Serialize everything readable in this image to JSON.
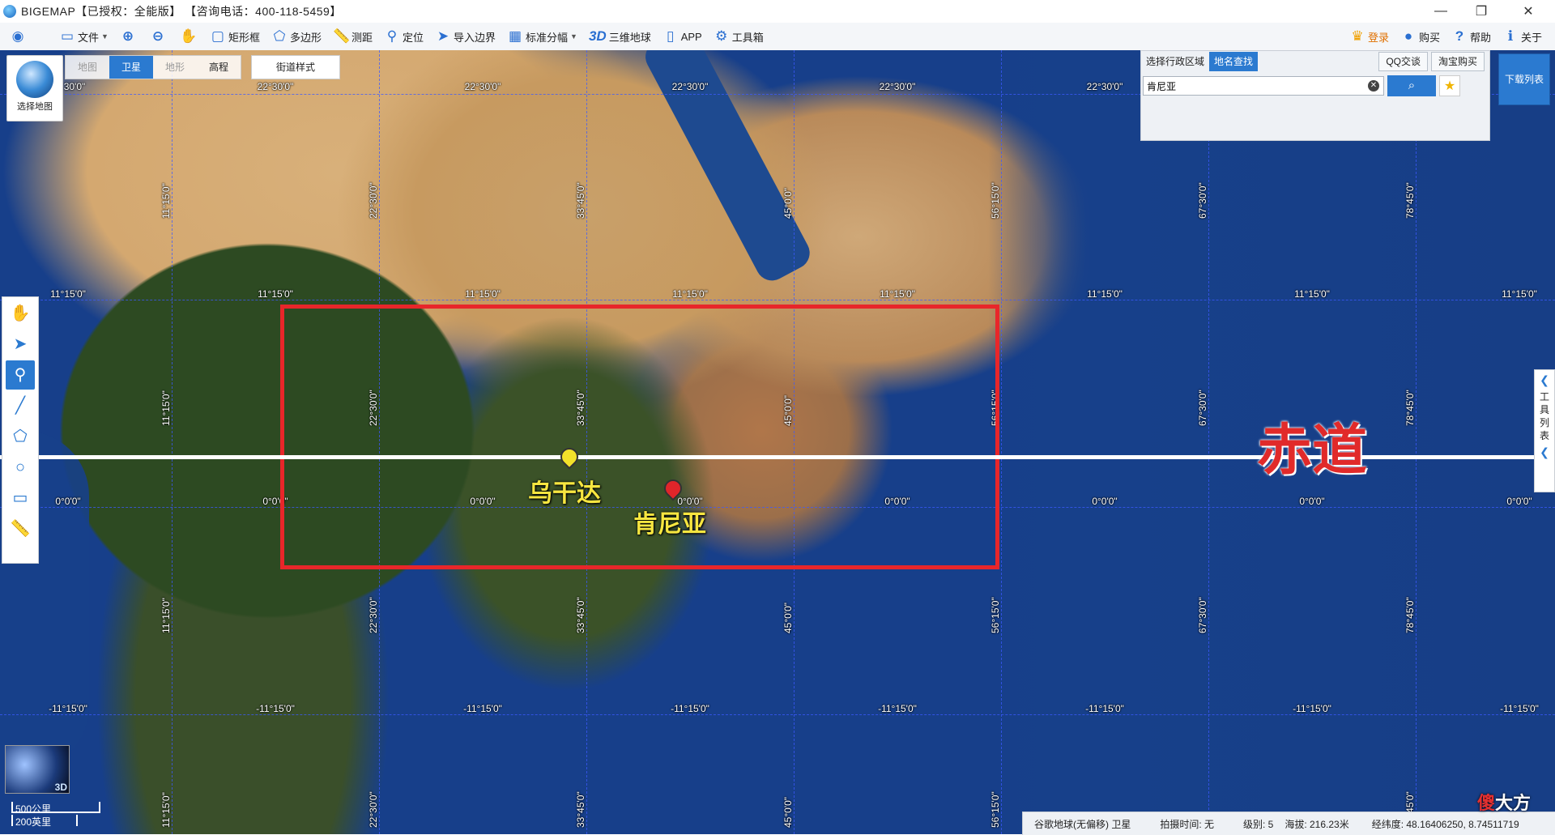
{
  "window": {
    "title": "BIGEMAP【已授权：全能版】 【咨询电话：400-118-5459】",
    "minimize_glyph": "—",
    "restore_glyph": "❐",
    "close_glyph": "✕"
  },
  "toolbar": {
    "file": "文件",
    "rect": "矩形框",
    "polygon": "多边形",
    "measure": "测距",
    "locate": "定位",
    "import_border": "导入边界",
    "standard_grid": "标准分幅",
    "three_d_prefix": "3D",
    "three_d_earth": "三维地球",
    "app": "APP",
    "toolbox": "工具箱",
    "login": "登录",
    "buy": "购买",
    "help": "帮助",
    "about": "关于"
  },
  "map_controls": {
    "select_map": "选择地图",
    "tabs": [
      "地图",
      "卫星",
      "地形",
      "高程"
    ],
    "active_tab": "卫星",
    "street_style": "街道样式"
  },
  "search": {
    "tab_admin": "选择行政区域",
    "tab_place": "地名查找",
    "qq": "QQ交谈",
    "taobao": "淘宝购买",
    "value": "肯尼亚"
  },
  "download_list": "下载列表",
  "right_panel": {
    "label": [
      "工",
      "具",
      "列",
      "表"
    ]
  },
  "grid_labels": {
    "top_lat": "22°30'0\"",
    "top_lat_left": "30'0\"",
    "north_lat": "11°15'0\"",
    "equator_lat": "0°0'0\"",
    "south_lat": "-11°15'0\"",
    "lon_1": "11°15'0\"",
    "lon_2": "22°30'0\"",
    "lon_3": "33°45'0\"",
    "lon_4": "45°0'0\"",
    "lon_5": "56°15'0\"",
    "lon_6": "67°30'0\"",
    "lon_7": "78°45'0\""
  },
  "annotations": {
    "equator": "赤道",
    "uganda": "乌干达",
    "kenya": "肯尼亚"
  },
  "mini_map": {
    "label": "3D"
  },
  "scale": {
    "metric": "500公里",
    "imperial": "200英里"
  },
  "statusbar": {
    "source": "谷歌地球(无偏移) 卫星",
    "capture_time": "拍摄时间: 无",
    "level": "级别:  5",
    "altitude": "海拔: 216.23米",
    "lonlat": "经纬度:  48.16406250, 8.74511719"
  },
  "watermark": {
    "a": "傻",
    "b": "大方"
  },
  "colors": {
    "accent": "#2b7ad0",
    "highlight_rect": "#e8262a",
    "label_yellow": "#f7e640"
  }
}
